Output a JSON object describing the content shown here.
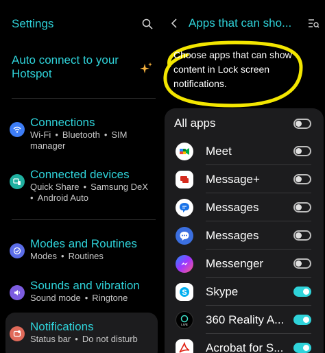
{
  "left": {
    "header_title": "Settings",
    "search_icon": "search-icon",
    "hotspot_text": "Auto connect to your Hotspot",
    "sparkle_icon": "sparkle-icon",
    "items": [
      {
        "title": "Connections",
        "subtitle": [
          "Wi-Fi",
          "Bluetooth",
          "SIM manager"
        ],
        "icon": "wifi-icon",
        "color": "#3d7df6"
      },
      {
        "title": "Connected devices",
        "subtitle": [
          "Quick Share",
          "Samsung DeX",
          "Android Auto"
        ],
        "icon": "devices-icon",
        "color": "#20b0a0"
      },
      {
        "title": "Modes and Routines",
        "subtitle": [
          "Modes",
          "Routines"
        ],
        "icon": "modes-icon",
        "color": "#5b6de8"
      },
      {
        "title": "Sounds and vibration",
        "subtitle": [
          "Sound mode",
          "Ringtone"
        ],
        "icon": "sound-icon",
        "color": "#7c5ce0"
      },
      {
        "title": "Notifications",
        "subtitle": [
          "Status bar",
          "Do not disturb"
        ],
        "icon": "bell-icon",
        "color": "#e06a5a"
      }
    ]
  },
  "right": {
    "header_title": "Apps that can sho...",
    "back_icon": "back-arrow-icon",
    "filter_icon": "filter-search-icon",
    "description": "Choose apps that can show content in Lock screen notifications.",
    "all_apps": {
      "label": "All apps",
      "on": false
    },
    "apps": [
      {
        "name": "Meet",
        "on": false,
        "icon": "meet-icon"
      },
      {
        "name": "Message+",
        "on": false,
        "icon": "message-plus-icon"
      },
      {
        "name": "Messages",
        "on": false,
        "icon": "google-messages-icon"
      },
      {
        "name": "Messages",
        "on": false,
        "icon": "samsung-messages-icon"
      },
      {
        "name": "Messenger",
        "on": false,
        "icon": "messenger-icon"
      },
      {
        "name": "Skype",
        "on": true,
        "icon": "skype-icon"
      },
      {
        "name": "360 Reality A...",
        "on": true,
        "icon": "live-icon"
      },
      {
        "name": "Acrobat for S...",
        "on": true,
        "icon": "acrobat-icon"
      }
    ]
  }
}
